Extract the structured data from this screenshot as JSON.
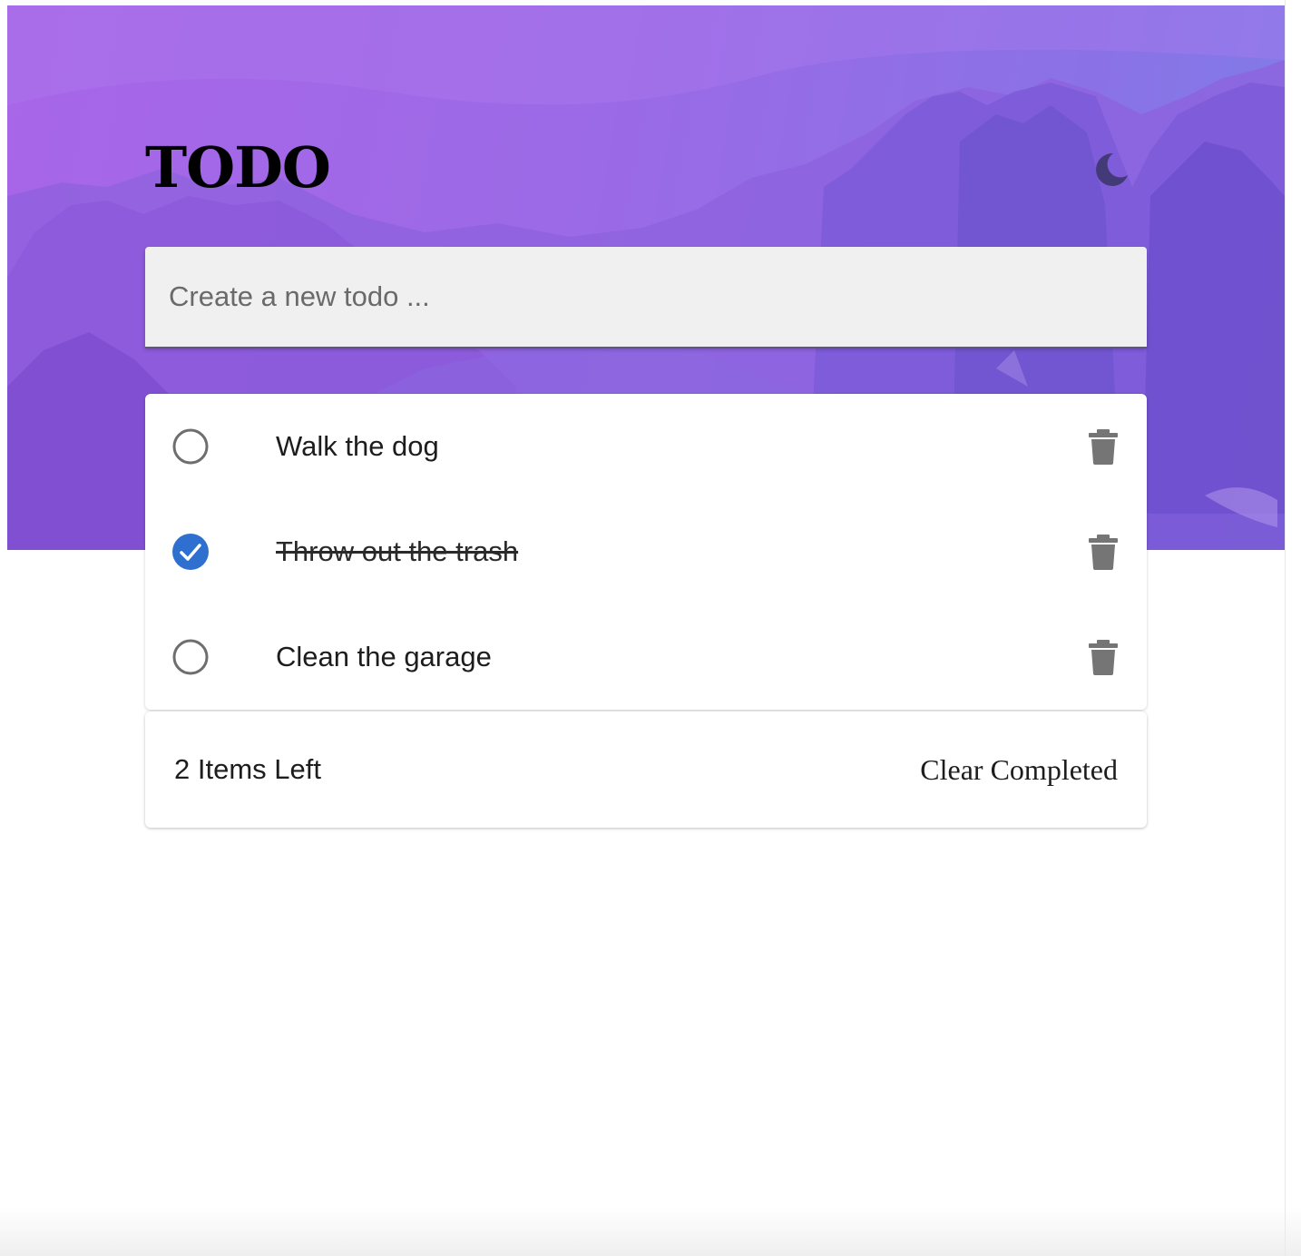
{
  "app": {
    "title": "TODO",
    "theme_toggle_icon": "moon-icon"
  },
  "new_todo": {
    "placeholder": "Create a new todo ...",
    "value": ""
  },
  "todos": [
    {
      "text": "Walk the dog",
      "completed": false
    },
    {
      "text": "Throw out the trash",
      "completed": true
    },
    {
      "text": "Clean the garage",
      "completed": false
    }
  ],
  "footer": {
    "items_left": "2 Items Left",
    "clear_completed": "Clear Completed"
  },
  "colors": {
    "hero_gradient_start": "#a866e8",
    "hero_gradient_end": "#7f7de8",
    "check_blue": "#2f6fd0",
    "icon_gray": "#757575",
    "moon": "#433a78"
  }
}
